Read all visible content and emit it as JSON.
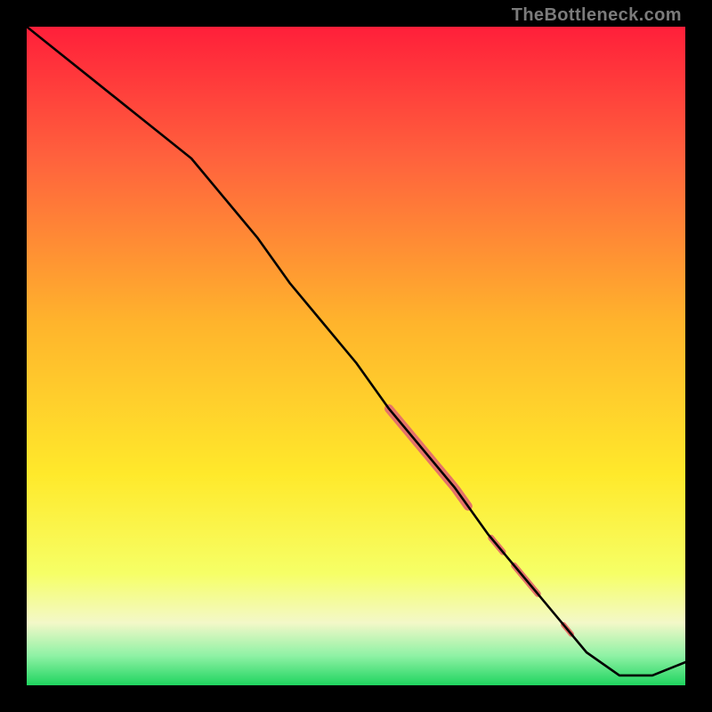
{
  "watermark": "TheBottleneck.com",
  "colors": {
    "bg": "#000000",
    "grad_top": "#ff1f3a",
    "grad_mid1": "#ff623d",
    "grad_mid2": "#ffb42c",
    "grad_mid3": "#ffe92b",
    "grad_mid4": "#f6ff66",
    "grad_bottom_cream": "#f3f8c8",
    "grad_green_light": "#8ff2a5",
    "grad_green": "#1fd45f",
    "curve": "#000000",
    "marker": "#e57368"
  },
  "chart_data": {
    "type": "line",
    "title": "",
    "xlabel": "",
    "ylabel": "",
    "xlim": [
      0,
      100
    ],
    "ylim": [
      0,
      100
    ],
    "x": [
      0,
      5,
      10,
      15,
      20,
      25,
      30,
      35,
      40,
      45,
      50,
      55,
      60,
      65,
      70,
      75,
      80,
      85,
      90,
      95,
      100
    ],
    "y": [
      100,
      96,
      92,
      88,
      84,
      80,
      74,
      68,
      61,
      55,
      49,
      42,
      36,
      30,
      23,
      17,
      11,
      5,
      1.5,
      1.5,
      3.5
    ],
    "marker_segments": [
      {
        "x_start": 55,
        "x_end": 67,
        "width": 10
      },
      {
        "x_start": 70.5,
        "x_end": 72.5,
        "width": 7
      },
      {
        "x_start": 74,
        "x_end": 78,
        "width": 7
      },
      {
        "x_start": 81.5,
        "x_end": 83.0,
        "width": 6
      }
    ],
    "gradient_stops": [
      {
        "offset": 0.0,
        "color_key": "grad_top"
      },
      {
        "offset": 0.2,
        "color_key": "grad_mid1"
      },
      {
        "offset": 0.45,
        "color_key": "grad_mid2"
      },
      {
        "offset": 0.68,
        "color_key": "grad_mid3"
      },
      {
        "offset": 0.83,
        "color_key": "grad_mid4"
      },
      {
        "offset": 0.905,
        "color_key": "grad_bottom_cream"
      },
      {
        "offset": 0.955,
        "color_key": "grad_green_light"
      },
      {
        "offset": 1.0,
        "color_key": "grad_green"
      }
    ]
  }
}
